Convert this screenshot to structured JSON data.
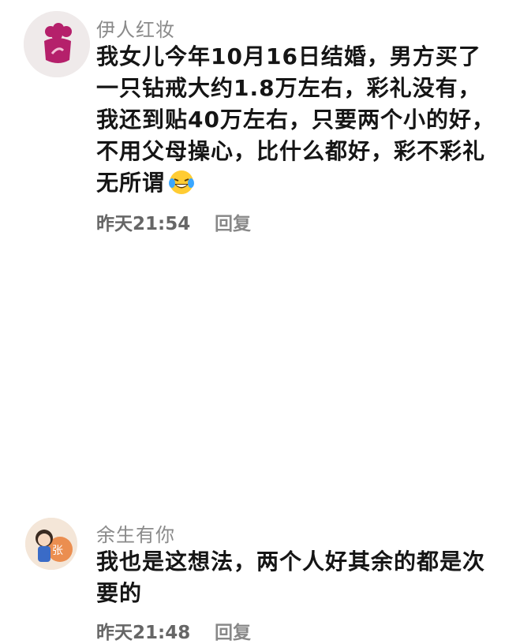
{
  "comments": [
    {
      "username": "伊人红妆",
      "text": "我女儿今年10月16日结婚，男方买了一只钻戒大约1.8万左右，彩礼没有，我还到贴40万左右，只要两个小的好，不用父母操心，比什么都好，彩不彩礼无所谓",
      "emoji": "laughing-crying-emoji",
      "time": "昨天21:54",
      "reply_label": "回复"
    },
    {
      "username": "余生有你",
      "text": "我也是这想法，两个人好其余的都是次要的",
      "time": "昨天21:48",
      "reply_label": "回复"
    }
  ],
  "avatars": [
    {
      "icon": "flower-avatar-icon",
      "accent": "#b5206b"
    },
    {
      "icon": "cartoon-girl-avatar-icon",
      "accent": "#e8782e"
    }
  ]
}
